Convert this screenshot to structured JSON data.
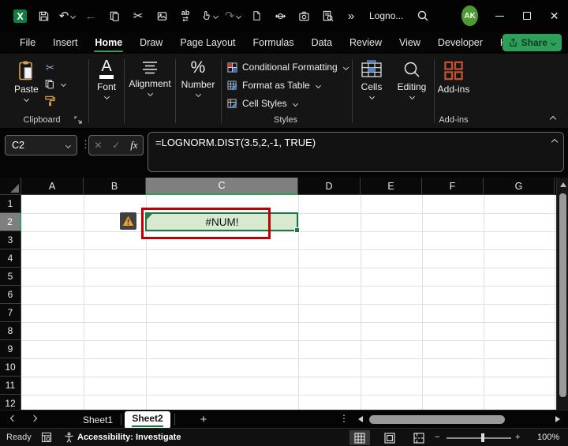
{
  "colors": {
    "accent_green": "#21A366",
    "selection_green": "#1A7A44",
    "share_green": "#2E9E5B",
    "error_red": "#C00000",
    "cell_fill_green": "#D8E9D0",
    "warning_orange": "#EFA432",
    "header_selected_gray": "#7F7F7F"
  },
  "icons": {
    "undo": "↶",
    "redo": "↷",
    "back": "←",
    "cut": "✂",
    "more_commands": "»",
    "close": "✕",
    "find_replace_top": "ab",
    "find_replace_bottom": "⇄",
    "vertical_dots": "⋮"
  },
  "titlebar": {
    "title": "Logno...",
    "avatar": "AK"
  },
  "menu": {
    "items": [
      "File",
      "Insert",
      "Home",
      "Draw",
      "Page Layout",
      "Formulas",
      "Data",
      "Review",
      "View",
      "Developer",
      "Help"
    ],
    "active": "Home",
    "share": "Share"
  },
  "ribbon": {
    "paste": "Paste",
    "clipboard_group": "Clipboard",
    "font_glyph": "A",
    "font_group": "Font",
    "alignment_group": "Alignment",
    "number_glyph": "%",
    "number_group": "Number",
    "styles_items": [
      "Conditional Formatting",
      "Format as Table",
      "Cell Styles"
    ],
    "styles_group": "Styles",
    "cells_group": "Cells",
    "editing_group": "Editing",
    "addins_button": "Add-ins",
    "addins_group": "Add-ins"
  },
  "formula_bar": {
    "name_box": "C2",
    "cancel": "✕",
    "enter": "✓",
    "fx": "fx",
    "formula": "=LOGNORM.DIST(3.5,2,-1, TRUE)"
  },
  "grid": {
    "columns": [
      "A",
      "B",
      "C",
      "D",
      "E",
      "F",
      "G"
    ],
    "rows": [
      "1",
      "2",
      "3",
      "4",
      "5",
      "6",
      "7",
      "8",
      "9",
      "10",
      "11",
      "12"
    ],
    "selected_cell": "C2",
    "selected_column": "C",
    "selected_row": "2",
    "error_value": "#NUM!"
  },
  "sheets": {
    "tabs": [
      "Sheet1",
      "Sheet2"
    ],
    "active": "Sheet2",
    "add": "+"
  },
  "status": {
    "mode": "Ready",
    "accessibility": "Accessibility: Investigate",
    "zoom_minus": "−",
    "zoom_plus": "+",
    "zoom": "100%"
  }
}
